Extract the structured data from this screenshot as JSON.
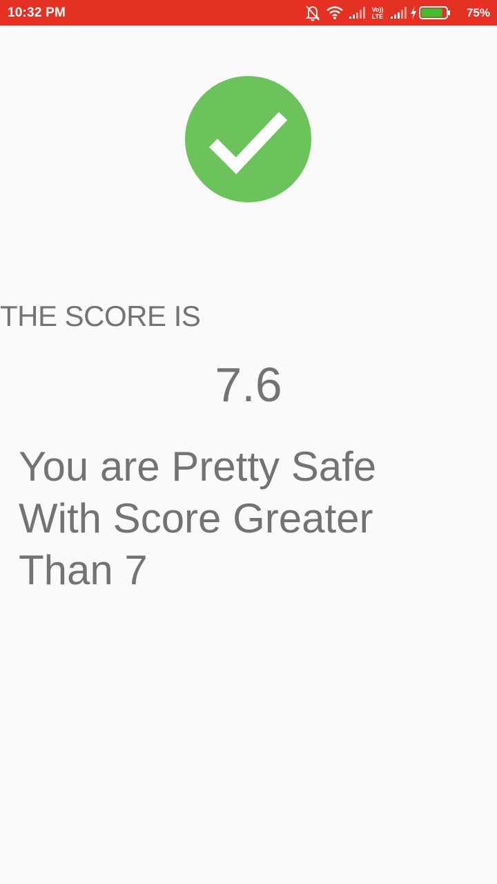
{
  "status_bar": {
    "time": "10:32 PM",
    "network_label": "VoLTE",
    "network_label_top": "Vo))",
    "network_label_bottom": "LTE",
    "battery_percent": "75%",
    "icons": [
      "mute-icon",
      "wifi-icon",
      "signal-icon",
      "signal-icon",
      "charging-icon",
      "battery-icon"
    ],
    "background_color": "#e53024"
  },
  "result": {
    "icon": "check-circle-icon",
    "icon_color": "#6cc35c",
    "score_label": "THE SCORE IS",
    "score_value": "7.6",
    "message": "You are Pretty Safe With Score Greater Than 7",
    "text_color": "#737373"
  }
}
